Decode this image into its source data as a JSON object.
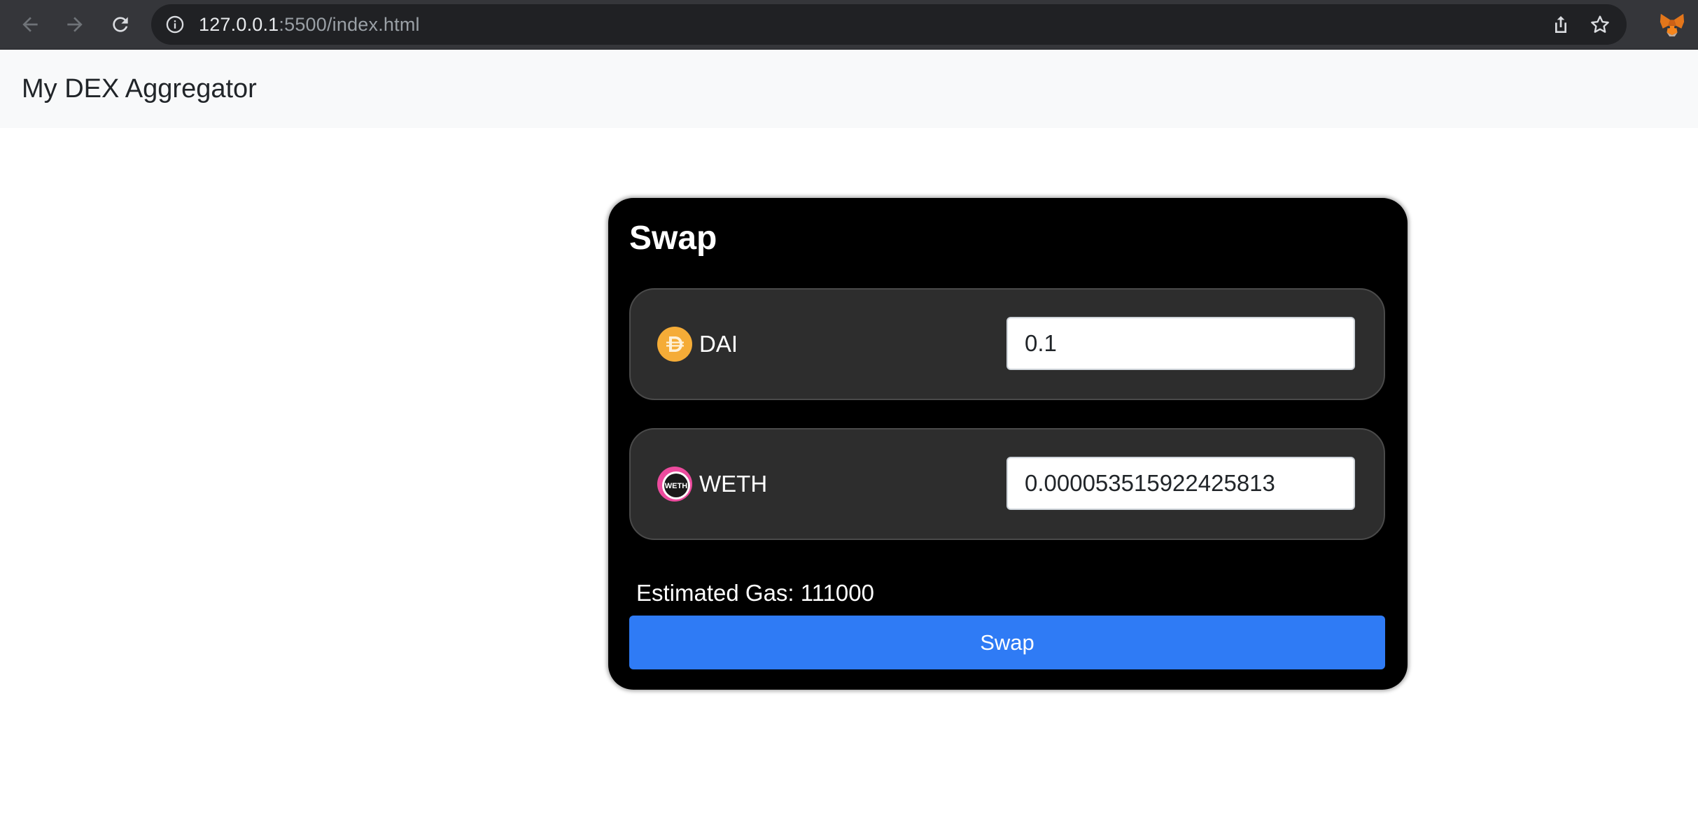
{
  "browser": {
    "url_host": "127.0.0.1",
    "url_path": ":5500/index.html",
    "icons": [
      "back-arrow-icon",
      "forward-arrow-icon",
      "reload-icon",
      "info-icon",
      "share-icon",
      "star-icon",
      "metamask-fox-icon"
    ]
  },
  "navbar": {
    "brand": "My DEX Aggregator"
  },
  "swap": {
    "title": "Swap",
    "from_token": {
      "symbol": "DAI",
      "icon": "dai-token-icon",
      "amount": "0.1"
    },
    "to_token": {
      "symbol": "WETH",
      "icon": "weth-token-icon",
      "icon_text": "WETH",
      "amount": "0.000053515922425813"
    },
    "gas_label": "Estimated Gas: 111000",
    "button_label": "Swap"
  },
  "colors": {
    "card_bg": "#000000",
    "panel_bg": "#2d2d2d",
    "button_bg": "#2f7bf5",
    "navbar_bg": "#f8f9fa",
    "dai_gold": "#f5ac37"
  }
}
